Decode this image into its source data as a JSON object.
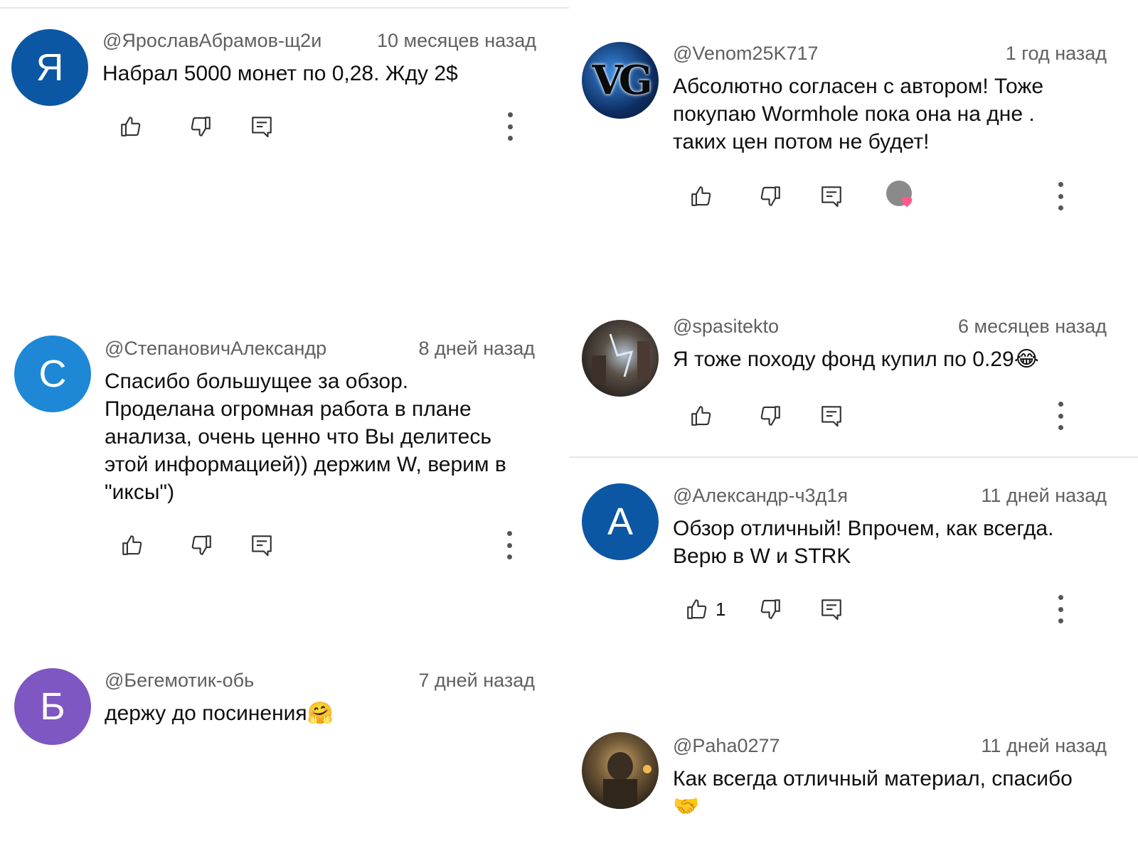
{
  "colors": {
    "avatar_ya": "#0b57a3",
    "avatar_s": "#1e88d6",
    "avatar_b": "#7e57c2",
    "avatar_a": "#0b57a3",
    "heart": "#ff5a8a"
  },
  "comments": [
    {
      "avatar_letter": "Я",
      "handle": "@ЯрославАбрамов-щ2и",
      "time": "10 месяцев назад",
      "text": "Набрал 5000 монет по 0,28. Жду 2$"
    },
    {
      "avatar_letter": "С",
      "handle": "@СтепановичАлександр",
      "time": "8 дней назад",
      "text": "Спасибо большущее за обзор.\nПроделана огромная работа в плане\nанализа, очень ценно что Вы делитесь\nэтой информацией)) держим W, верим в\n\"иксы\")"
    },
    {
      "avatar_letter": "Б",
      "handle": "@Бегемотик-обь",
      "time": "7 дней назад",
      "text": "держу до посинения🤗"
    },
    {
      "avatar_label": "VG",
      "handle": "@Venom25K717",
      "time": "1 год назад",
      "text": "Абсолютно согласен с автором! Тоже\nпокупаю Wormhole  пока она на дне .\nтаких цен потом не будет!"
    },
    {
      "handle": "@spasitekto",
      "time": "6 месяцев назад",
      "text": "Я тоже походу фонд купил по 0.29😂"
    },
    {
      "avatar_letter": "А",
      "handle": "@Александр-ч3д1я",
      "time": "11 дней назад",
      "text": "Обзор отличный! Впрочем, как всегда.\nВерю в W и STRK",
      "like_count": "1"
    },
    {
      "handle": "@Paha0277",
      "time": "11 дней назад",
      "text": "Как всегда отличный материал, спасибо\n🤝"
    }
  ]
}
